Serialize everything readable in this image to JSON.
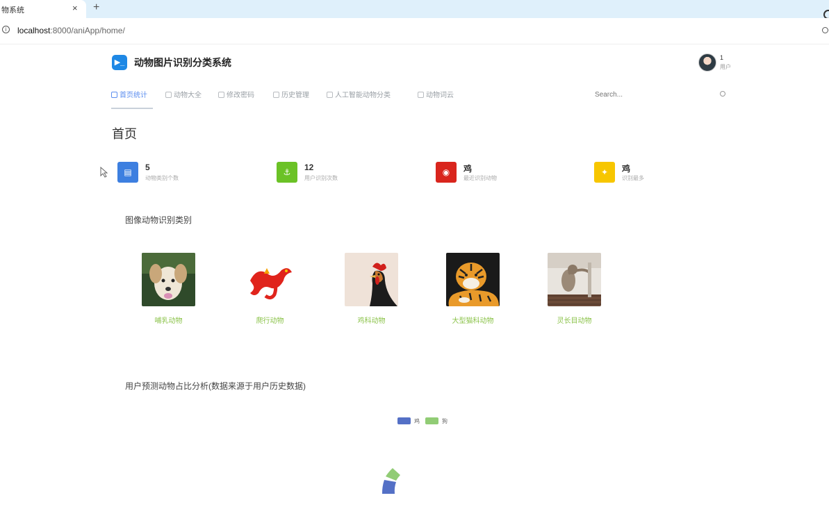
{
  "browser": {
    "tab_title": "物系统",
    "tab_close": "×",
    "new_tab": "+",
    "url_host": "localhost",
    "url_path": ":8000/aniApp/home/"
  },
  "app": {
    "title": "动物图片识别分类系统",
    "logo_glyph": "▶_",
    "accent_color": "#1e88e5"
  },
  "user": {
    "name": "1",
    "role": "用户"
  },
  "nav": {
    "items": [
      {
        "label": "首页统计",
        "active": true
      },
      {
        "label": "动物大全",
        "active": false
      },
      {
        "label": "修改密码",
        "active": false
      },
      {
        "label": "历史管理",
        "active": false
      },
      {
        "label": "人工智能动物分类",
        "active": false
      },
      {
        "label": "动物词云",
        "active": false
      }
    ],
    "search_placeholder": "Search..."
  },
  "page": {
    "title": "首页"
  },
  "stats": [
    {
      "value": "5",
      "label": "动物类别个数",
      "color": "#3d7fe0",
      "icon": "db-icon"
    },
    {
      "value": "12",
      "label": "用户识别次数",
      "color": "#6bc226",
      "icon": "anchor-icon"
    },
    {
      "value": "鸡",
      "label": "最近识别动物",
      "color": "#d9251d",
      "icon": "eye-icon"
    },
    {
      "value": "鸡",
      "label": "识别最多",
      "color": "#f7c600",
      "icon": "star-icon"
    }
  ],
  "categories_section": {
    "title": "图像动物识别类别",
    "items": [
      {
        "label": "哺乳动物",
        "image": "dog-photo"
      },
      {
        "label": "爬行动物",
        "image": "dragon-photo"
      },
      {
        "label": "鸡科动物",
        "image": "rooster-photo"
      },
      {
        "label": "大型猫科动物",
        "image": "tiger-photo"
      },
      {
        "label": "灵长目动物",
        "image": "monkey-photo"
      }
    ]
  },
  "chart_section": {
    "title": "用户预测动物占比分析(数据来源于用户历史数据)"
  },
  "chart_data": {
    "type": "pie",
    "series": [
      {
        "name": "鸡",
        "color": "#5470c6"
      },
      {
        "name": "狗",
        "color": "#91cc75"
      }
    ],
    "legend_position": "top-center"
  }
}
